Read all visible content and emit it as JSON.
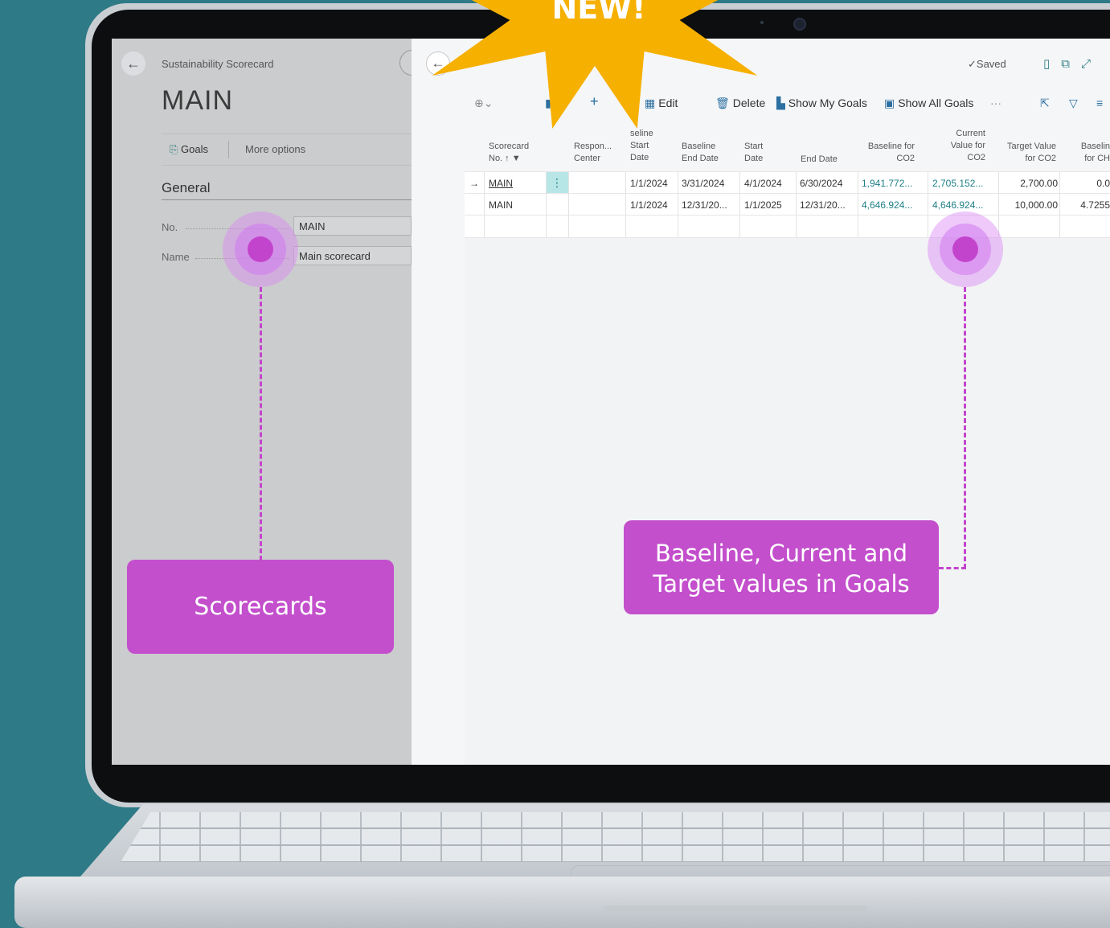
{
  "badge": {
    "text": "NEW!"
  },
  "left_panel": {
    "breadcrumb": "Sustainability Scorecard",
    "title": "MAIN",
    "goals_action": "Goals",
    "more_options": "More options",
    "section": "General",
    "fields": [
      {
        "label": "No.",
        "value": "MAIN"
      },
      {
        "label": "Name",
        "value": "Main scorecard"
      }
    ]
  },
  "right_panel": {
    "saved": "Saved",
    "toolbar": {
      "edit": "Edit",
      "delete": "Delete",
      "show_my_goals": "Show My Goals",
      "show_all_goals": "Show All Goals",
      "more": "···"
    },
    "headers": {
      "scorecard_1": "Scorecard",
      "scorecard_2": "No. ↑",
      "resp_1": "Respon...",
      "resp_2": "Center",
      "bstart_1": "seline",
      "bstart_2": "Start",
      "bstart_3": "Date",
      "bend_1": "Baseline",
      "bend_2": "End Date",
      "start_1": "Start",
      "start_2": "Date",
      "end": "End Date",
      "bfor_1": "Baseline for",
      "bfor_2": "CO2",
      "cur_1": "Current",
      "cur_2": "Value for",
      "cur_3": "CO2",
      "tgt_1": "Target Value",
      "tgt_2": "for CO2",
      "bch_1": "Baselin",
      "bch_2": "for CH"
    },
    "rows": [
      {
        "scorecard": "MAIN",
        "bstart": "1/1/2024",
        "bend": "3/31/2024",
        "start": "4/1/2024",
        "end": "6/30/2024",
        "baseline": "1,941.772...",
        "current": "2,705.152...",
        "target": "2,700.00",
        "bch": "0.0"
      },
      {
        "scorecard": "MAIN",
        "bstart": "1/1/2024",
        "bend": "12/31/20...",
        "start": "1/1/2025",
        "end": "12/31/20...",
        "baseline": "4,646.924...",
        "current": "4,646.924...",
        "target": "10,000.00",
        "bch": "4.7255"
      }
    ]
  },
  "callouts": {
    "scorecards": "Scorecards",
    "goals_line1": "Baseline, Current and",
    "goals_line2": "Target values in Goals"
  },
  "colors": {
    "background": "#2e7a86",
    "accent": "#c344cc",
    "badge": "#f6b000",
    "teal": "#1c7f86"
  }
}
